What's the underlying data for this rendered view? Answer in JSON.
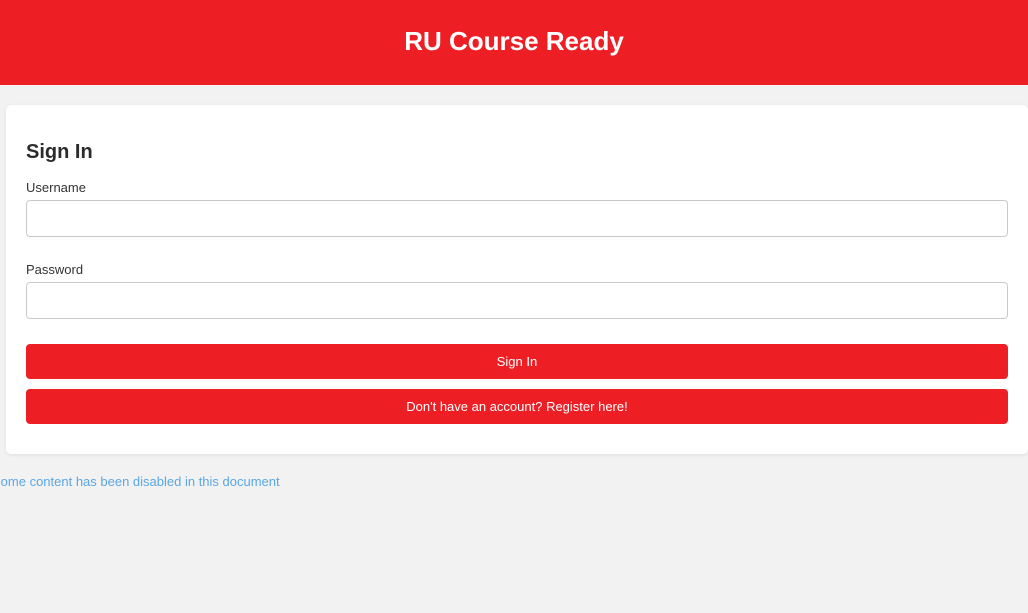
{
  "header": {
    "title": "RU Course Ready"
  },
  "signin": {
    "heading": "Sign In",
    "username_label": "Username",
    "username_value": "",
    "password_label": "Password",
    "password_value": "",
    "signin_button_label": "Sign In",
    "register_button_label": "Don't have an account? Register here!"
  },
  "notice": {
    "text": "Some content has been disabled in this document"
  },
  "colors": {
    "brand_red": "#ed1f24",
    "background": "#f2f2f2",
    "notice_blue": "#5aa7e6"
  }
}
